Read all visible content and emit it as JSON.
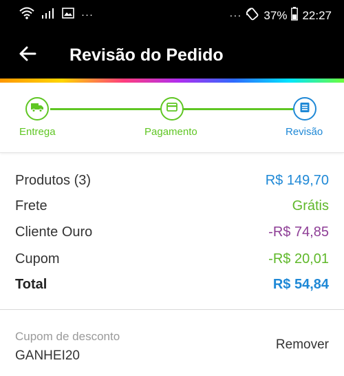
{
  "status_bar": {
    "battery": "37%",
    "time": "22:27",
    "left_icons": [
      "wifi-icon",
      "signal-icon",
      "gallery-notification-icon"
    ],
    "more_left": "···",
    "more_right": "···"
  },
  "header": {
    "title": "Revisão do Pedido",
    "back_icon": "arrow-left-icon"
  },
  "stepper": {
    "steps": [
      {
        "label": "Entrega",
        "icon": "truck-icon",
        "state": "done"
      },
      {
        "label": "Pagamento",
        "icon": "card-icon",
        "state": "done"
      },
      {
        "label": "Revisão",
        "icon": "list-icon",
        "state": "active"
      }
    ]
  },
  "summary": {
    "rows": [
      {
        "label": "Produtos (3)",
        "value": "R$ 149,70",
        "color": "#1e88d6"
      },
      {
        "label": "Frete",
        "value": "Grátis",
        "color": "#5fb82a"
      },
      {
        "label": "Cliente Ouro",
        "value": "-R$ 74,85",
        "color": "#8e3e96"
      },
      {
        "label": "Cupom",
        "value": "-R$ 20,01",
        "color": "#5fb82a"
      }
    ],
    "total": {
      "label": "Total",
      "value": "R$ 54,84",
      "color": "#1e88d6"
    }
  },
  "coupon": {
    "label": "Cupom de desconto",
    "code": "GANHEI20",
    "remove_label": "Remover"
  },
  "colors": {
    "step_green": "#5fc623",
    "step_active_blue": "#1e88d6"
  }
}
